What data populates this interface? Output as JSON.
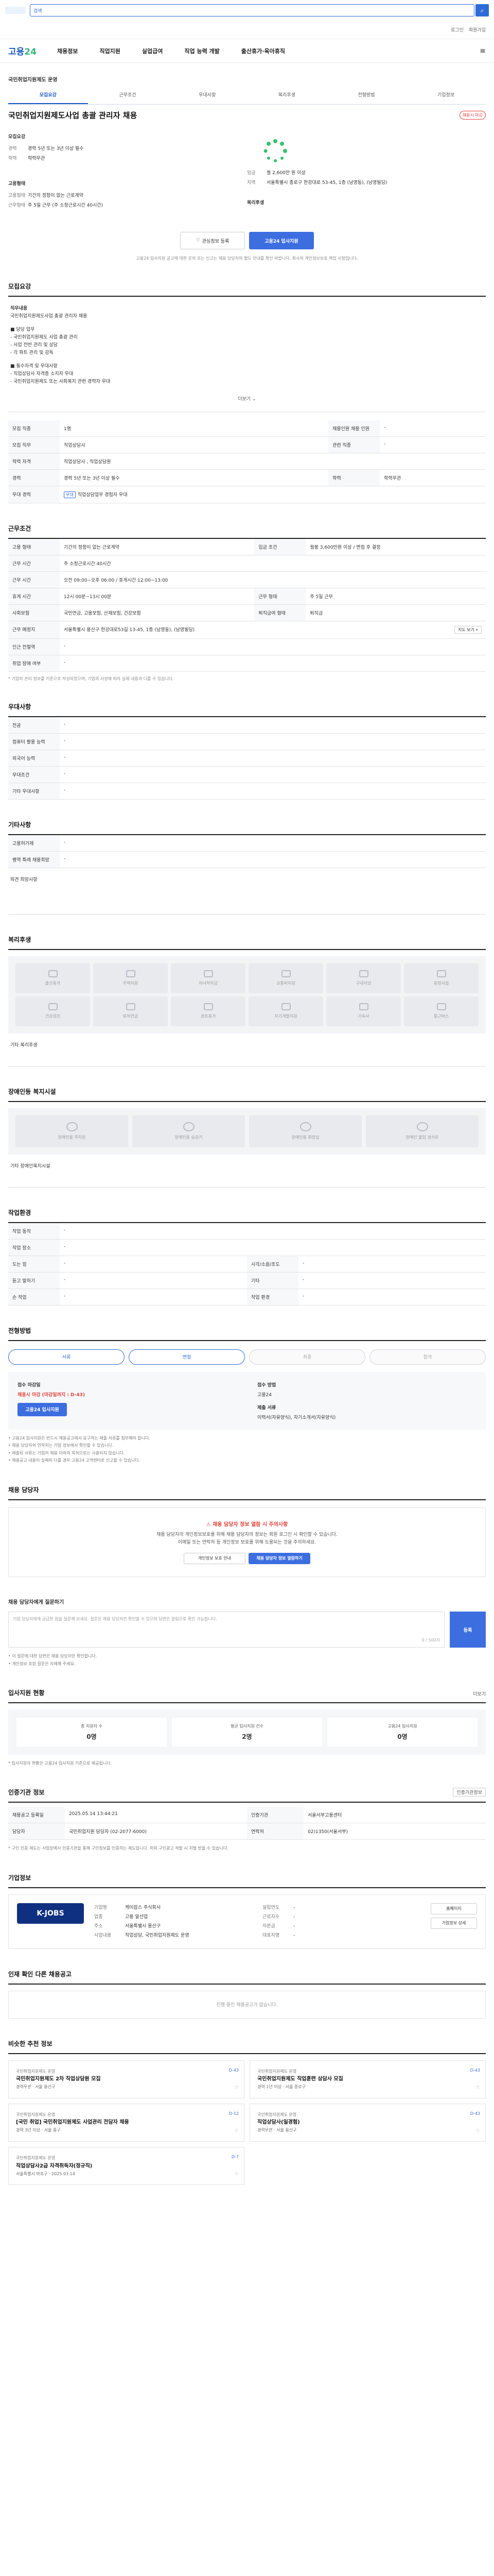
{
  "topbar": {
    "search_placeholder": "",
    "search_prefix": "검색"
  },
  "util": [
    "로그인",
    "회원가입"
  ],
  "gnb": {
    "brand_a": "고용",
    "brand_b": "24",
    "menu": [
      "채용정보",
      "직업지원",
      "실업급여",
      "직업 능력 개발",
      "출산휴가·육아휴직"
    ]
  },
  "job": {
    "company": "국민취업지원제도 운영",
    "title": "국민취업지원제도사업 총괄 관리자 채용",
    "badge": "채용시 마감",
    "tabs": [
      "모집요강",
      "근무조건",
      "우대사항",
      "복리후생",
      "전형방법",
      "기업정보"
    ],
    "left": {
      "header": "모집요강",
      "rows": [
        {
          "k": "경력",
          "v": "경력 5년 또는 3년 이상 필수"
        },
        {
          "k": "학력",
          "v": "학력무관"
        }
      ]
    },
    "right": {
      "header": "",
      "rows": [
        {
          "k": "임금",
          "v": "월 2,600만 원 이상"
        },
        {
          "k": "지역",
          "v": "서울특별시 종로구 한강대로 53-45, 1층 (남영동), (남영빌딩)"
        }
      ]
    },
    "left2": {
      "header": "고용형태",
      "rows": [
        {
          "k": "고용형태",
          "v": "기간의 정함이 없는 근로계약"
        },
        {
          "k": "근무형태",
          "v": "주 5일 근무 (주 소정근로시간 40시간)"
        }
      ]
    },
    "right2": {
      "header": "복리후생",
      "rows": []
    },
    "btn_save": "관심정보 등록",
    "btn_apply": "고용24 입사지원",
    "notice": "고용24 입사지원 공고에 대한 문의 또는 신고는 채용 담당자의 별도 안내를 확인 바랍니다. 회사의 개인정보보호 책임 사항입니다."
  },
  "sections": {
    "recruit": {
      "title": "모집요강",
      "duty_h": "직무내용",
      "duty": "국민취업지원제도사업 총괄 관리자 채용",
      "bullets": [
        "■ 담당 업무",
        "- 국민취업지원제도 사업 총괄 관리",
        "- 사업 전반 관리 및 상담",
        "- 각 파트 관리 및 감독",
        "",
        "■ 필수자격 및 우대사항",
        "- 직업상담사 자격증 소지자 우대",
        "- 국민취업지원제도 또는 사회복지 관련 경력자 우대"
      ],
      "more": "더보기",
      "rows": [
        {
          "k": "모집 직종",
          "v": "1명",
          "k2": "채용인원 채용 인원",
          "v2": "-"
        },
        {
          "k": "모집 직무",
          "v": "직업상담사",
          "k2": "관련 직종",
          "v2": "-"
        },
        {
          "k": "학력 자격",
          "v": "직업상담사 , 직업상담원",
          "k2": "",
          "v2": ""
        },
        {
          "k": "경력",
          "v": "경력 5년 또는 3년 이상 필수",
          "k2": "학력",
          "v2": "학력무관"
        },
        {
          "k": "우대 경력",
          "v": "직업상담업무 경험자 우대",
          "k2": "",
          "v2": ""
        }
      ]
    },
    "conditions": {
      "title": "근무조건",
      "rows": [
        {
          "k": "고용 형태",
          "v": "기간의 정함이 없는 근로계약",
          "k2": "입금 조건",
          "v2": "월봉 3,600만원 이상 / 면접 후 결정"
        },
        {
          "k": "근무 시간",
          "v": "주 소정근로시간 40시간",
          "k2": "",
          "v2": ""
        },
        {
          "k": "근무 시간",
          "v": "오전 09:00~오후 06:00 / 휴게시간 12:00~13:00",
          "k2": "",
          "v2": ""
        },
        {
          "k": "휴게 시간",
          "v": "12시 00분~13시 00분",
          "k2": "근무 형태",
          "v2": "주 5일 근무"
        },
        {
          "k": "사회보험",
          "v": "국민연금, 고용보험, 산재보험, 건강보험",
          "k2": "퇴직금여 형태",
          "v2": "퇴직금"
        },
        {
          "k": "근무 예정지",
          "v": "서울특별시 용산구 한강대로53길 13-45, 1층 (남영동), (남영빌딩)",
          "k2": "",
          "v2": ""
        },
        {
          "k": "인근 전철역",
          "v": "-",
          "k2": "",
          "v2": ""
        },
        {
          "k": "취업 장애 여부",
          "v": "-",
          "k2": "",
          "v2": ""
        }
      ],
      "map_btn": "지도 보기",
      "notice": "* 기업의 관리 정보를 기준으로 작성되었으며, 기업의 사정에 따라 실제 내용과 다를 수 있습니다."
    },
    "preferred": {
      "title": "우대사항",
      "rows": [
        {
          "k": "전공",
          "v": "-"
        },
        {
          "k": "컴퓨터 활용 능력",
          "v": "-"
        },
        {
          "k": "외국어 능력",
          "v": "-"
        },
        {
          "k": "우대조건",
          "v": "-"
        },
        {
          "k": "기타 우대사항",
          "v": "-"
        }
      ]
    },
    "etc": {
      "title": "기타사항",
      "rows": [
        {
          "k": "고용허가제",
          "v": "-"
        },
        {
          "k": "병역 특례 채용희망",
          "v": "-"
        }
      ],
      "dispatch": "파견 희망사항"
    },
    "welfare": {
      "title": "복리후생",
      "items": [
        "출산휴가",
        "주택지원",
        "자녀학자금",
        "교통비지원",
        "구내식당",
        "휴양시설",
        "건강검진",
        "퇴직연금",
        "경조휴가",
        "자기개발지원",
        "기숙사",
        "통근버스"
      ],
      "other_h": "기타 복리후생",
      "other": ""
    },
    "facility": {
      "title": "장애인등 복지시설",
      "items": [
        "장애인용 주차장",
        "장애인용 승강기",
        "장애인용 화장실",
        "장애인 출입 경사로"
      ],
      "other": "기타 장애인복지시설"
    },
    "workenv": {
      "title": "작업환경",
      "rows": [
        {
          "k": "작업 동작",
          "v": "-",
          "k2": "",
          "v2": ""
        },
        {
          "k": "작업 장소",
          "v": "-",
          "k2": "",
          "v2": ""
        },
        {
          "k": "도는 힘",
          "v": "-",
          "k2": "시각/소음/조도",
          "v2": "-"
        },
        {
          "k": "듣고 말하기",
          "v": "-",
          "k2": "기타",
          "v2": "-"
        },
        {
          "k": "손 작업",
          "v": "-",
          "k2": "작업 환경",
          "v2": "-"
        }
      ]
    },
    "process": {
      "title": "전형방법",
      "steps": [
        "서류",
        "면접",
        "최종",
        "합격"
      ],
      "apply_h": "접수 마감일",
      "apply_date": "채용시 마감 (마감일까지 : D-43)",
      "method_h": "접수 방법",
      "method": "고용24",
      "docs_h": "제출 서류",
      "docs": "이력서(자유양식), 자기소개서(자유양식)",
      "apply_btn": "고용24 입사지원",
      "list": [
        "• 고용24 입사지원은 반드시 채용공고에서 요구하는 제출 서류를 첨부해야 합니다.",
        "• 채용 담당자의 연락처는 기업 정보에서 확인할 수 있습니다.",
        "• 제출된 서류는 기업의 채용 이외의 목적으로는 사용되지 않습니다.",
        "• 채용공고 내용이 실제와 다를 경우 고용24 고객센터로 신고할 수 있습니다."
      ]
    },
    "manager": {
      "title": "채용 담당자",
      "alert": "채용 담당자 정보 열람 시 주의사항",
      "desc1": "채용 담당자의 개인정보보호를 위해 채용 담당자의 정보는 회원 로그인 시 확인할 수 있습니다.",
      "desc2": "이메일 또는 연락처 등 개인정보 보호를 위해 도용되는 것을 주의하세요.",
      "btn1": "개인정보 보호 안내",
      "btn2": "채용 담당자 정보 열람하기"
    },
    "qa": {
      "title": "채용 담당자에게 질문하기",
      "placeholder": "기업 담당자에게 궁금한 점을 질문해 보세요. 질문은 채용 담당자만 확인할 수 있으며 답변은 알림으로 확인 가능합니다.",
      "count": "0 / 500자",
      "submit": "등록",
      "notes": [
        "• 이 질문에 대한 답변은 채용 담당자만 확인합니다.",
        "• 개인정보 포함 질문은 자제해 주세요."
      ]
    },
    "stats": {
      "title": "입사지원 현황",
      "more": "더보기",
      "cards": [
        {
          "label": "총 지원자 수",
          "n": "0명"
        },
        {
          "label": "평균 입사지원 건수",
          "n": "2명"
        },
        {
          "label": "고용24 입사지원",
          "n": "0명"
        }
      ],
      "note": "* 입사지원자 현황은 고용24 입사지원 기준으로 제공됩니다."
    },
    "reginfo": {
      "title": "인증기관 정보",
      "btn": "인증기관정보",
      "rows": [
        {
          "k": "채용공고 등록일",
          "v": "2025.05.14 13:44:21",
          "k2": "인증기관",
          "v2": "서울서부고용센터"
        },
        {
          "k": "담당자",
          "v": "국민취업지원 담당자 (02-2077-6000)",
          "k2": "연락처",
          "v2": "02)1350(서울서부)"
        }
      ],
      "note": "* 구인 인증 제도는 사업장에서 인증기관을 통해 구인정보를 인증하는 제도입니다. 허위 구인광고 적발 시 처벌 받을 수 있습니다."
    },
    "company": {
      "title": "기업정보",
      "logo_text": "K-JOBS",
      "left": [
        {
          "k": "기업명",
          "v": "케이잡스 주식회사"
        },
        {
          "k": "업종",
          "v": "고용 알선업"
        },
        {
          "k": "주소",
          "v": "서울특별시 용산구"
        },
        {
          "k": "사업내용",
          "v": "직업상담, 국민취업지원제도 운영"
        }
      ],
      "right": [
        {
          "k": "설립연도",
          "v": "-"
        },
        {
          "k": "근로자수",
          "v": "-"
        },
        {
          "k": "자본금",
          "v": "-"
        },
        {
          "k": "대표자명",
          "v": "-"
        }
      ],
      "btn1": "홈페이지",
      "btn2": "기업정보 상세"
    },
    "others": {
      "title": "인재 확인 다른 채용공고",
      "empty": "진행 중인 채용공고가 없습니다."
    },
    "recommend": {
      "title": "비슷한 추천 정보",
      "cards": [
        {
          "co": "국민취업지원제도 운영",
          "title": "국민취업지원제도 2차 직업상담원 모집",
          "meta": "경력무관 · 서울 용산구",
          "tag": "D-43"
        },
        {
          "co": "국민취업지원제도 운영",
          "title": "국민취업지원제도 직업훈련 상담사 모집",
          "meta": "경력 1년 이상 · 서울 종로구",
          "tag": "D-43"
        },
        {
          "co": "국민취업지원제도 운영",
          "title": "[국민 취업] 국민취업지원제도 사업관리 전담자 채용",
          "meta": "경력 3년 이상 · 서울 중구",
          "tag": "D-12"
        },
        {
          "co": "국민취업지원제도 운영",
          "title": "직업상담사(일경험)",
          "meta": "경력무관 · 서울 용산구",
          "tag": "D-43"
        },
        {
          "co": "국민취업지원제도 운영",
          "title": "직업상담사2급 자격취득자(정규직)",
          "meta": "서울특별시 마포구 · 2025.03.14",
          "tag": "D-7"
        }
      ]
    }
  }
}
